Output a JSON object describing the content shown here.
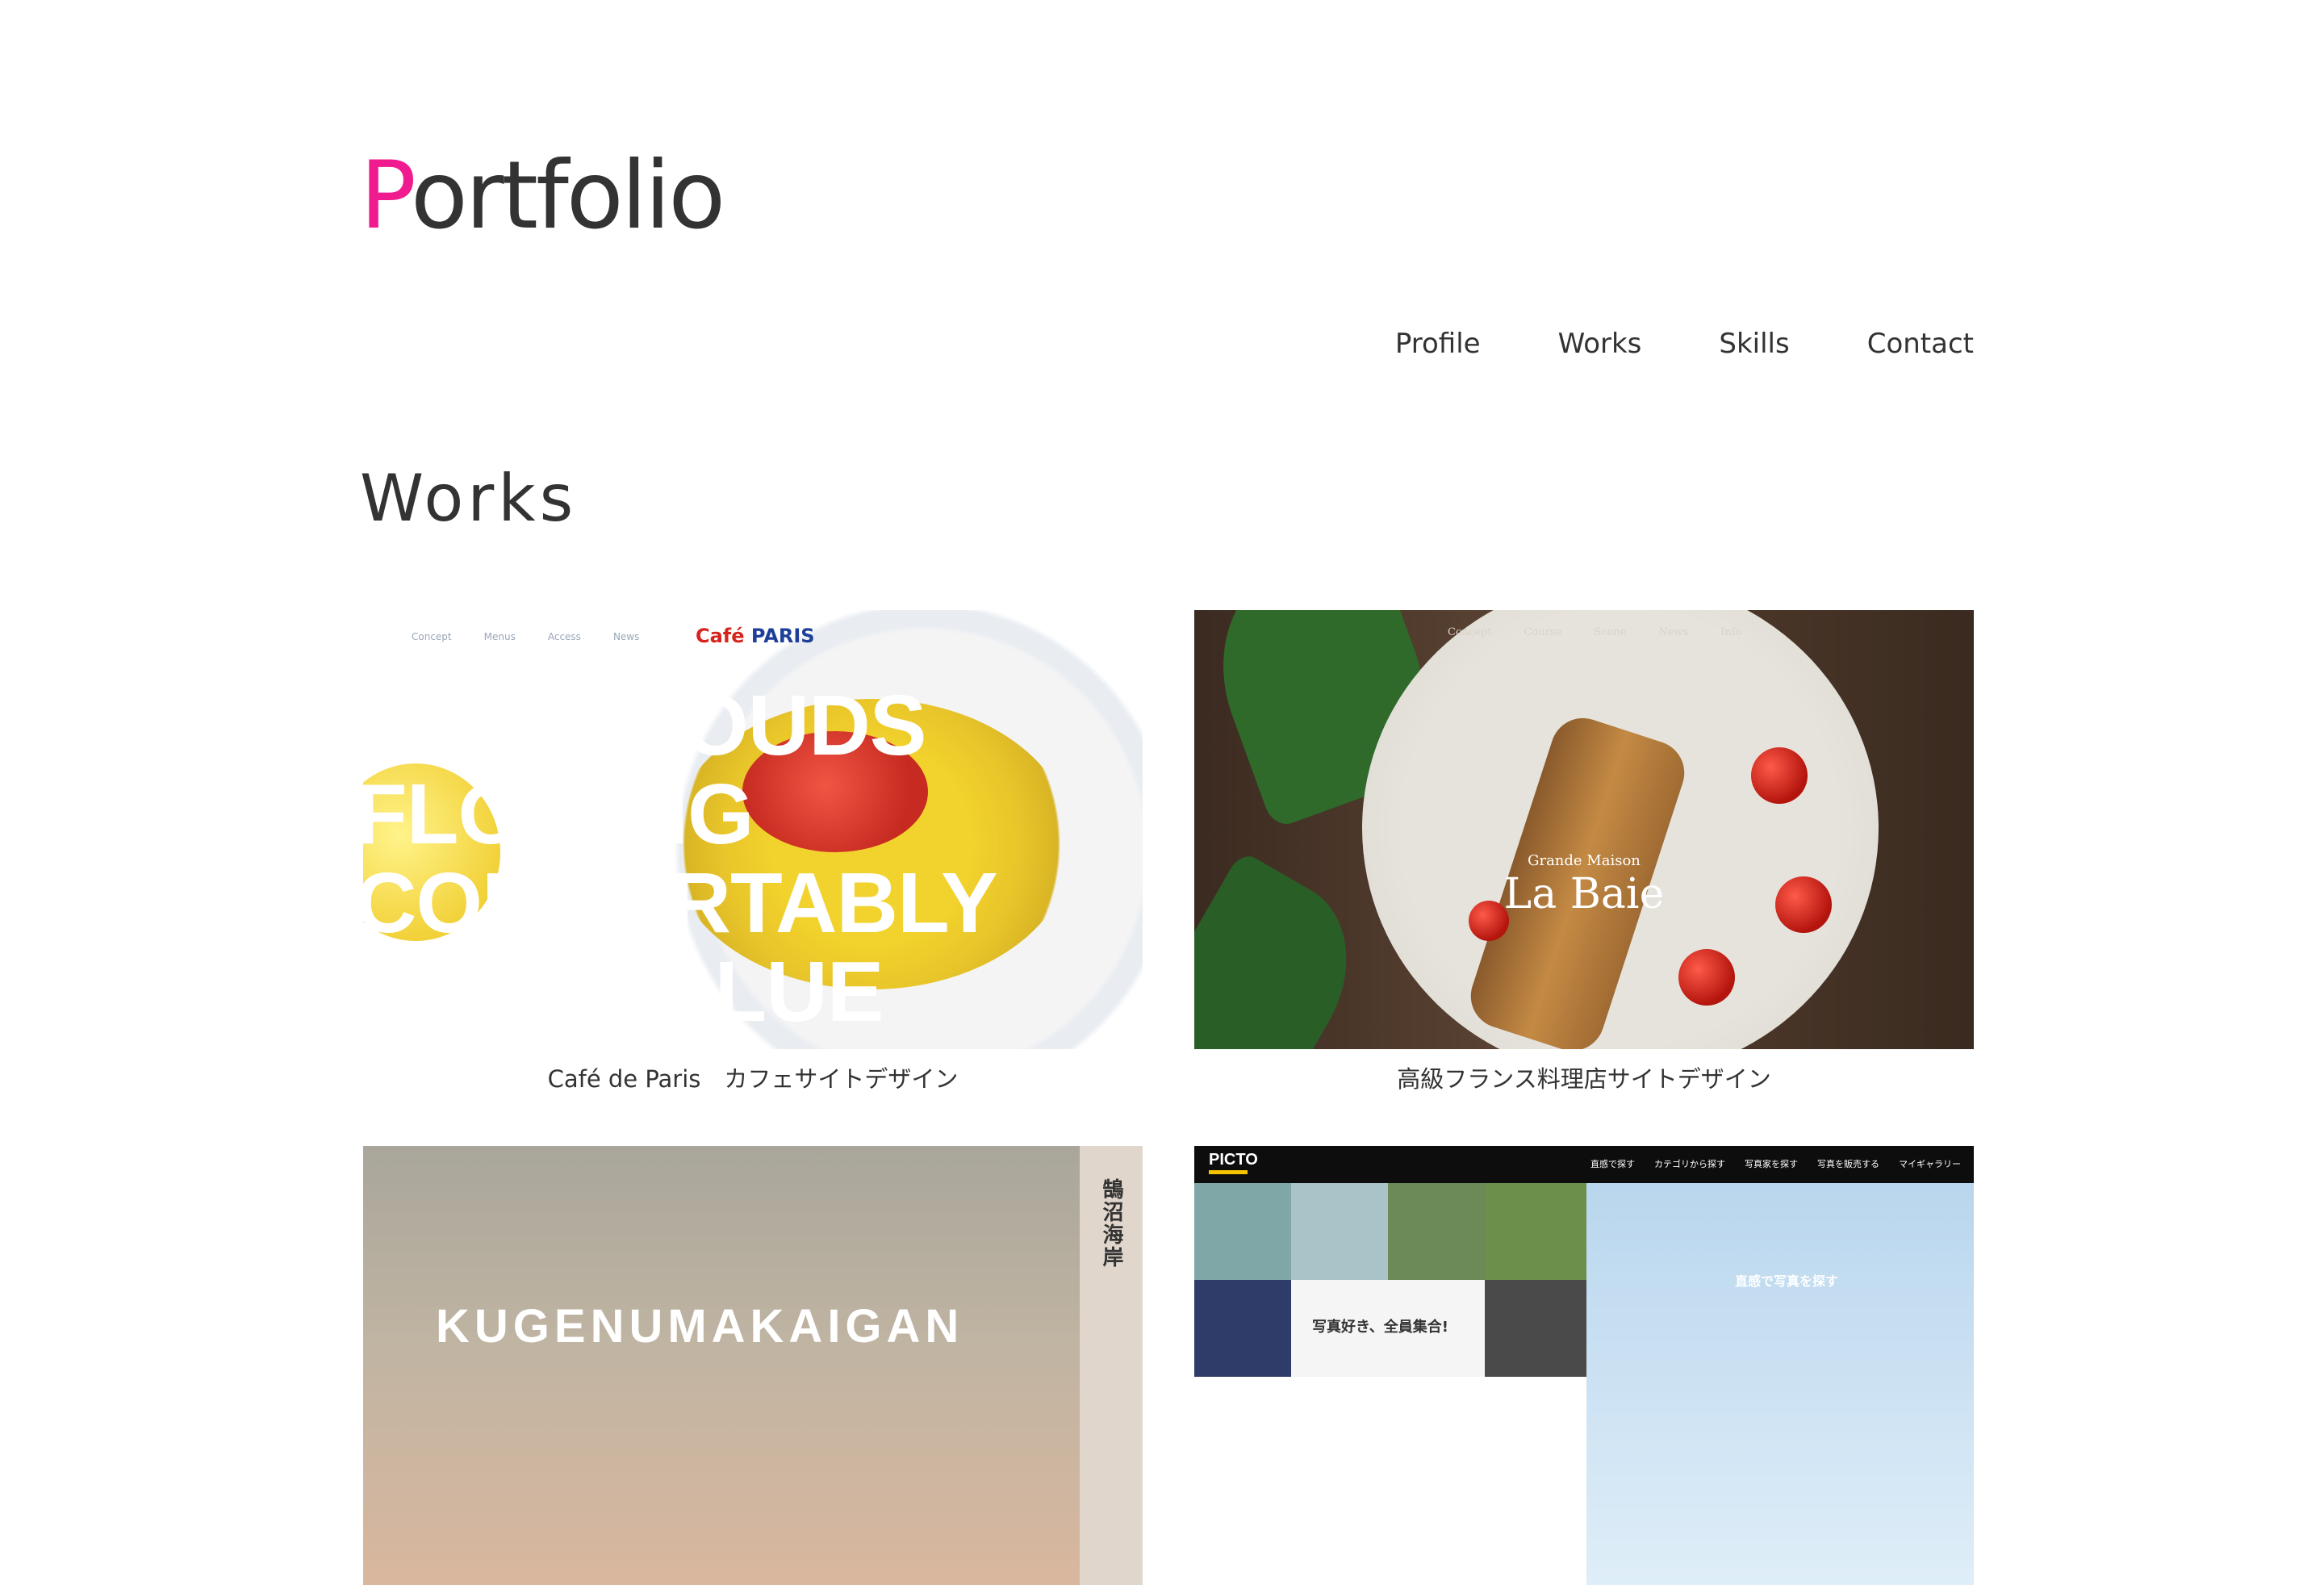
{
  "header": {
    "logo_first": "P",
    "logo_rest": "ortfolio",
    "accent_color": "#f01c8f"
  },
  "nav": {
    "items": [
      {
        "label": "Profile"
      },
      {
        "label": "Works"
      },
      {
        "label": "Skills"
      },
      {
        "label": "Contact"
      }
    ]
  },
  "works": {
    "title": "Works",
    "cards": [
      {
        "caption": "Café de Paris　カフェサイトデザイン",
        "thumb_nav": [
          "Concept",
          "Menus",
          "Access",
          "News"
        ],
        "brand_a": "Café",
        "brand_b": "PARIS",
        "headline_1": "LIKE CLOUDS",
        "headline_2": "FLOWING",
        "headline_3": "COMFORTABLY",
        "headline_4": "IN THE BLUE"
      },
      {
        "caption": "高級フランス料理店サイトデザイン",
        "thumb_nav": [
          "Concept",
          "Course",
          "Scene",
          "News",
          "Info"
        ],
        "brand_small": "Grande Maison",
        "brand_big": "La Baie"
      },
      {
        "caption": "",
        "vertical_text": "鵠沼海岸",
        "big_text": "KUGENUMAKAIGAN"
      },
      {
        "caption": "",
        "logo": "PICTO",
        "menu": [
          "直感で探す",
          "カテゴリから探す",
          "写真家を探す",
          "写真を販売する",
          "マイギャラリー"
        ],
        "wheel_text": "直感で写真を探す",
        "low_text": "写真好き、全員集合!"
      }
    ]
  }
}
